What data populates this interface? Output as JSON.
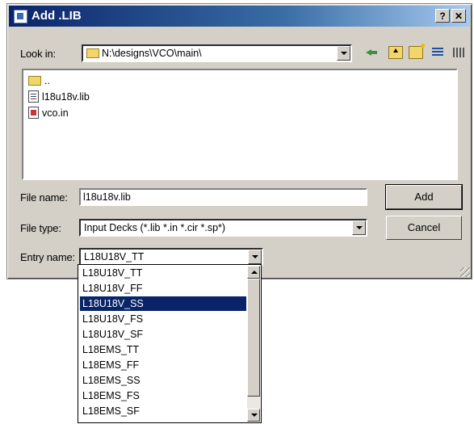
{
  "window": {
    "title": "Add .LIB",
    "help_label": "?",
    "close_label": "✕",
    "accent_color": "#0a246a"
  },
  "look_in": {
    "label": "Look in:",
    "value": "N:\\designs\\VCO\\main\\"
  },
  "toolbar": {
    "icons": [
      "back-arrow-icon",
      "up-folder-icon",
      "new-folder-icon",
      "list-view-icon",
      "details-view-icon"
    ]
  },
  "files": [
    {
      "name": "..",
      "icon": "folder-icon"
    },
    {
      "name": "l18u18v.lib",
      "icon": "document-icon"
    },
    {
      "name": "vco.in",
      "icon": "input-file-icon"
    }
  ],
  "file_name": {
    "label": "File name:",
    "value": "l18u18v.lib"
  },
  "file_type": {
    "label": "File type:",
    "value": "Input Decks (*.lib *.in *.cir *.sp*)"
  },
  "entry_name": {
    "label": "Entry name:",
    "value": "L18U18V_TT",
    "options": [
      "L18U18V_TT",
      "L18U18V_FF",
      "L18U18V_SS",
      "L18U18V_FS",
      "L18U18V_SF",
      "L18EMS_TT",
      "L18EMS_FF",
      "L18EMS_SS",
      "L18EMS_FS",
      "L18EMS_SF"
    ],
    "selected_index": 2
  },
  "buttons": {
    "add": "Add",
    "cancel": "Cancel"
  }
}
